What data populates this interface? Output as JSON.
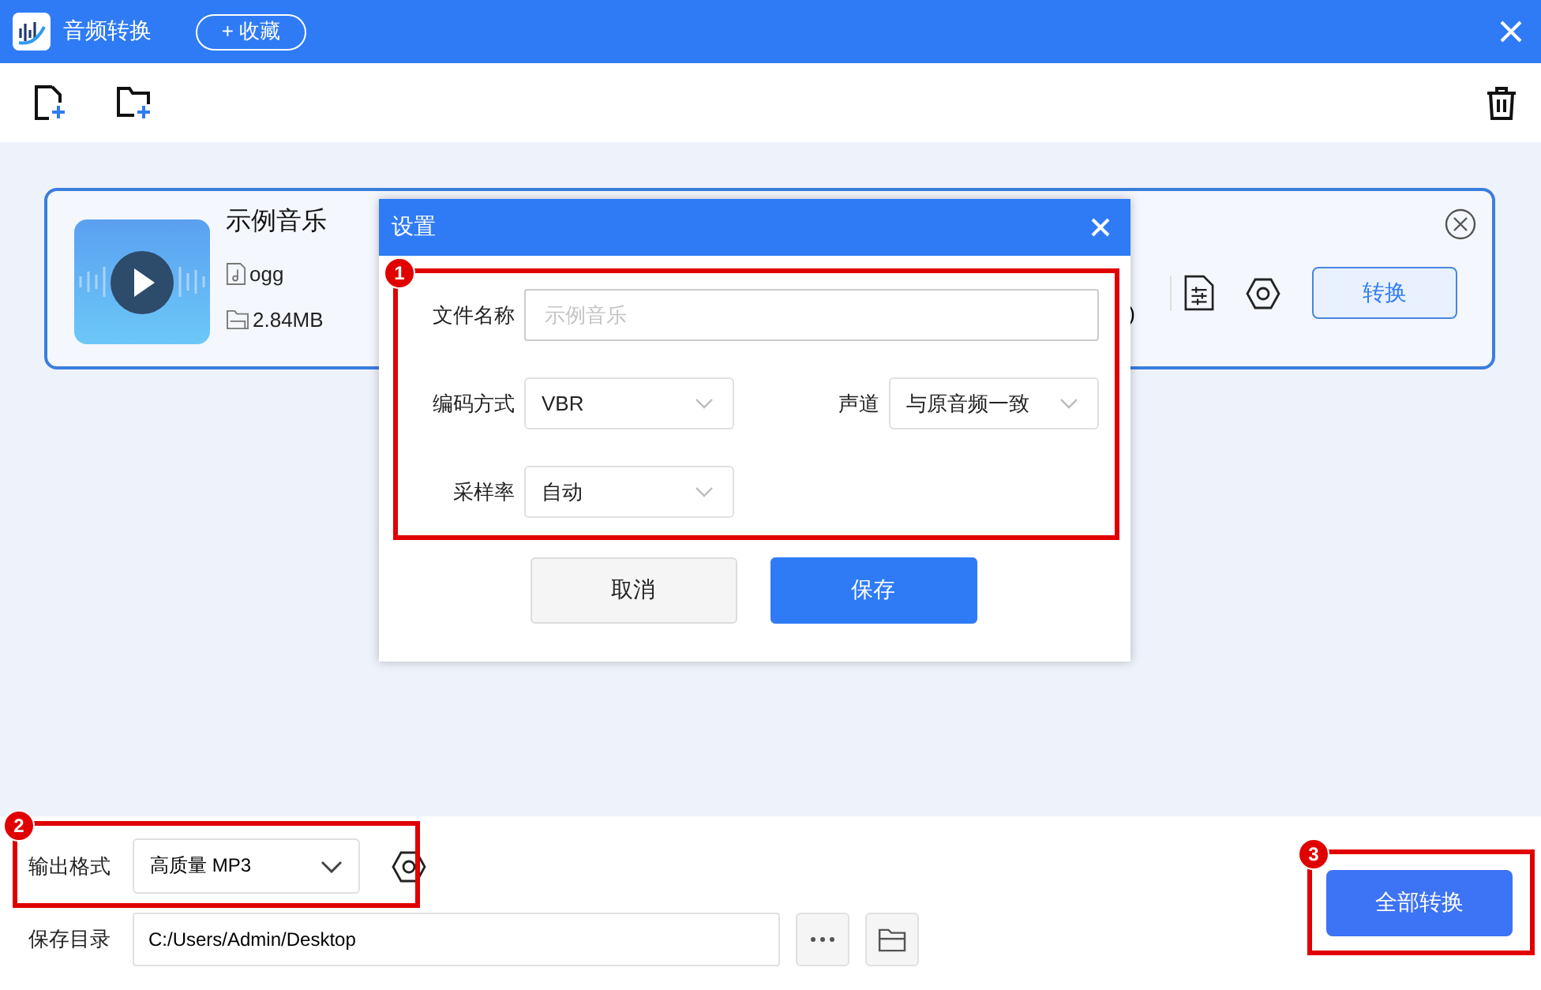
{
  "window": {
    "title": "音频转换",
    "favorite_button": "+ 收藏"
  },
  "file_card": {
    "title": "示例音乐",
    "format": "ogg",
    "size": "2.84MB",
    "partial_text": ")",
    "convert_button": "转换"
  },
  "dialog": {
    "title": "设置",
    "rows": [
      [
        {
          "kind": "text",
          "label": "文件名称",
          "placeholder": "示例音乐"
        }
      ],
      [
        {
          "kind": "select",
          "label": "编码方式",
          "value": "VBR"
        },
        {
          "kind": "select",
          "label": "声道",
          "value": "与原音频一致"
        }
      ],
      [
        {
          "kind": "select",
          "label": "采样率",
          "value": "自动"
        }
      ]
    ],
    "buttons": [
      {
        "label": "取消",
        "primary": false
      },
      {
        "label": "保存",
        "primary": true
      }
    ]
  },
  "output": {
    "format_label": "输出格式",
    "format_value": "高质量 MP3",
    "dir_label": "保存目录",
    "dir_value": "C:/Users/Admin/Desktop",
    "convert_all_button": "全部转换"
  },
  "annotations": [
    {
      "label": "1"
    },
    {
      "label": "2"
    },
    {
      "label": "3"
    }
  ]
}
